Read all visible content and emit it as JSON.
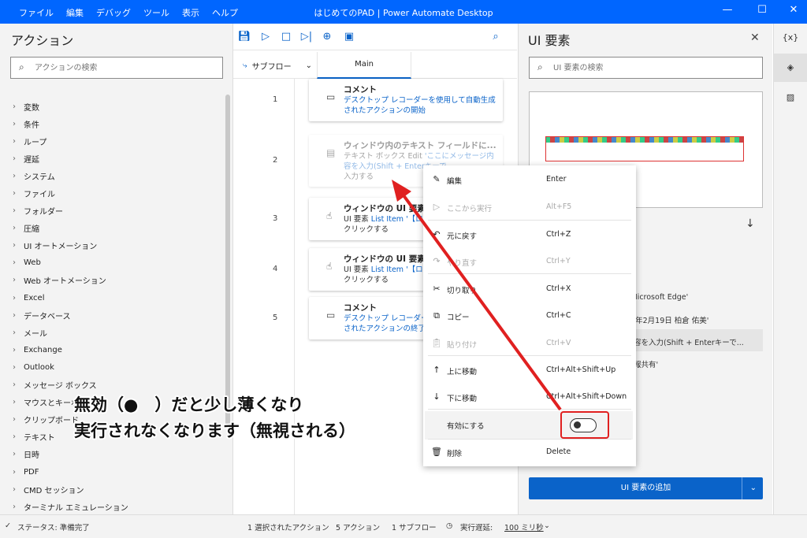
{
  "titlebar": {
    "menus": [
      "ファイル",
      "編集",
      "デバッグ",
      "ツール",
      "表示",
      "ヘルプ"
    ],
    "title": "はじめてのPAD | Power Automate Desktop",
    "min": "—",
    "max": "☐",
    "close": "✕"
  },
  "actions": {
    "title": "アクション",
    "search_placeholder": "アクションの検索",
    "categories": [
      "変数",
      "条件",
      "ループ",
      "遅延",
      "システム",
      "ファイル",
      "フォルダー",
      "圧縮",
      "UI オートメーション",
      "Web",
      "Web オートメーション",
      "Excel",
      "データベース",
      "メール",
      "Exchange",
      "Outlook",
      "メッセージ ボックス",
      "マウスとキーボード",
      "クリップボード",
      "テキスト",
      "日時",
      "PDF",
      "CMD セッション",
      "ターミナル エミュレーション"
    ]
  },
  "toolbar": {
    "icons": [
      "save-icon",
      "play-icon",
      "stop-icon",
      "step-icon",
      "web-recorder-icon",
      "desktop-recorder-icon",
      "search-icon"
    ]
  },
  "tabs": {
    "subflow": "サブフロー",
    "main": "Main"
  },
  "steps": [
    {
      "n": "1",
      "title": "コメント",
      "desc_blue": "デスクトップ レコーダーを使用して自動生成されたアクションの開始",
      "desc": ""
    },
    {
      "n": "2",
      "title": "ウィンドウ内のテキスト フィールドに...",
      "desc": "テキスト ボックス Edit ",
      "desc_blue": "'ここにメッセージ内容を入力(Shift + Enterキーで",
      "desc2": "入力する"
    },
    {
      "n": "3",
      "title": "ウィンドウの UI 要素を",
      "desc": "UI 要素 ",
      "desc_blue": "List Item '【ロ",
      "desc2": "クリックする"
    },
    {
      "n": "4",
      "title": "ウィンドウの UI 要素を",
      "desc": "UI 要素 ",
      "desc_blue": "List Item '【ロボ",
      "desc2": "クリックする"
    },
    {
      "n": "5",
      "title": "コメント",
      "desc_blue": "デスクトップ レコーダーを使用して自動生成されたアクションの終了",
      "desc": ""
    }
  ],
  "ui_elements": {
    "title": "UI 要素",
    "search_placeholder": "UI 要素の検索",
    "texts": [
      ". - Microsoft Edge'",
      "021年2月19日 柏倉 佑美'",
      "容を入力(Shift + Enterキーで...",
      "報共有'"
    ],
    "add_button": "UI 要素の追加"
  },
  "rail": {
    "vars": "{x}"
  },
  "context_menu": {
    "items": [
      {
        "label": "編集",
        "shortcut": "Enter",
        "icon": "pencil-icon",
        "disabled": false
      },
      {
        "label": "ここから実行",
        "shortcut": "Alt+F5",
        "icon": "run-from-here-icon",
        "disabled": true
      },
      {
        "label": "元に戻す",
        "shortcut": "Ctrl+Z",
        "icon": "undo-icon",
        "disabled": false
      },
      {
        "label": "やり直す",
        "shortcut": "Ctrl+Y",
        "icon": "redo-icon",
        "disabled": true
      },
      {
        "label": "切り取り",
        "shortcut": "Ctrl+X",
        "icon": "cut-icon",
        "disabled": false
      },
      {
        "label": "コピー",
        "shortcut": "Ctrl+C",
        "icon": "copy-icon",
        "disabled": false
      },
      {
        "label": "貼り付け",
        "shortcut": "Ctrl+V",
        "icon": "paste-icon",
        "disabled": true
      },
      {
        "label": "上に移動",
        "shortcut": "Ctrl+Alt+Shift+Up",
        "icon": "arrow-up-icon",
        "disabled": false
      },
      {
        "label": "下に移動",
        "shortcut": "Ctrl+Alt+Shift+Down",
        "icon": "arrow-down-icon",
        "disabled": false
      },
      {
        "label": "有効にする",
        "shortcut": "",
        "icon": "",
        "disabled": false
      },
      {
        "label": "削除",
        "shortcut": "Delete",
        "icon": "trash-icon",
        "disabled": false
      }
    ],
    "toggle_on": false
  },
  "annotation": {
    "line1": "無効（●　）だと少し薄くなり",
    "line2": "実行されなくなります（無視される）"
  },
  "status": {
    "ready": "ステータス: 準備完了",
    "selected": "1 選択されたアクション",
    "actions": "5 アクション",
    "subflows": "1 サブフロー",
    "delay_label": "実行遅延:",
    "delay_value": "100 ミリ秒"
  },
  "colors": {
    "brand": "#0066ff",
    "accent": "#0a63c9",
    "annotation_red": "#e02020"
  }
}
